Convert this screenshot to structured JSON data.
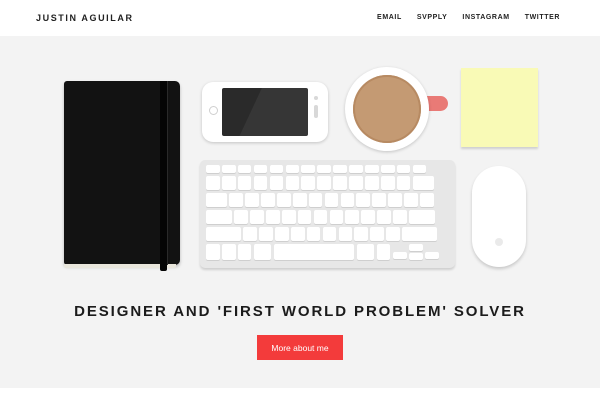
{
  "header": {
    "brand": "JUSTIN AGUILAR",
    "nav": [
      "EMAIL",
      "SVPPLY",
      "INSTAGRAM",
      "TWITTER"
    ]
  },
  "hero": {
    "tagline": "DESIGNER AND 'FIRST WORLD PROBLEM' SOLVER",
    "cta_label": "More about me"
  },
  "colors": {
    "accent": "#f33b3b",
    "background": "#f3f3f3",
    "text": "#1b1b1b"
  },
  "icons": [
    "notebook-illustration",
    "phone-illustration",
    "coffee-cup-illustration",
    "sticky-note-illustration",
    "keyboard-illustration",
    "mouse-illustration"
  ]
}
